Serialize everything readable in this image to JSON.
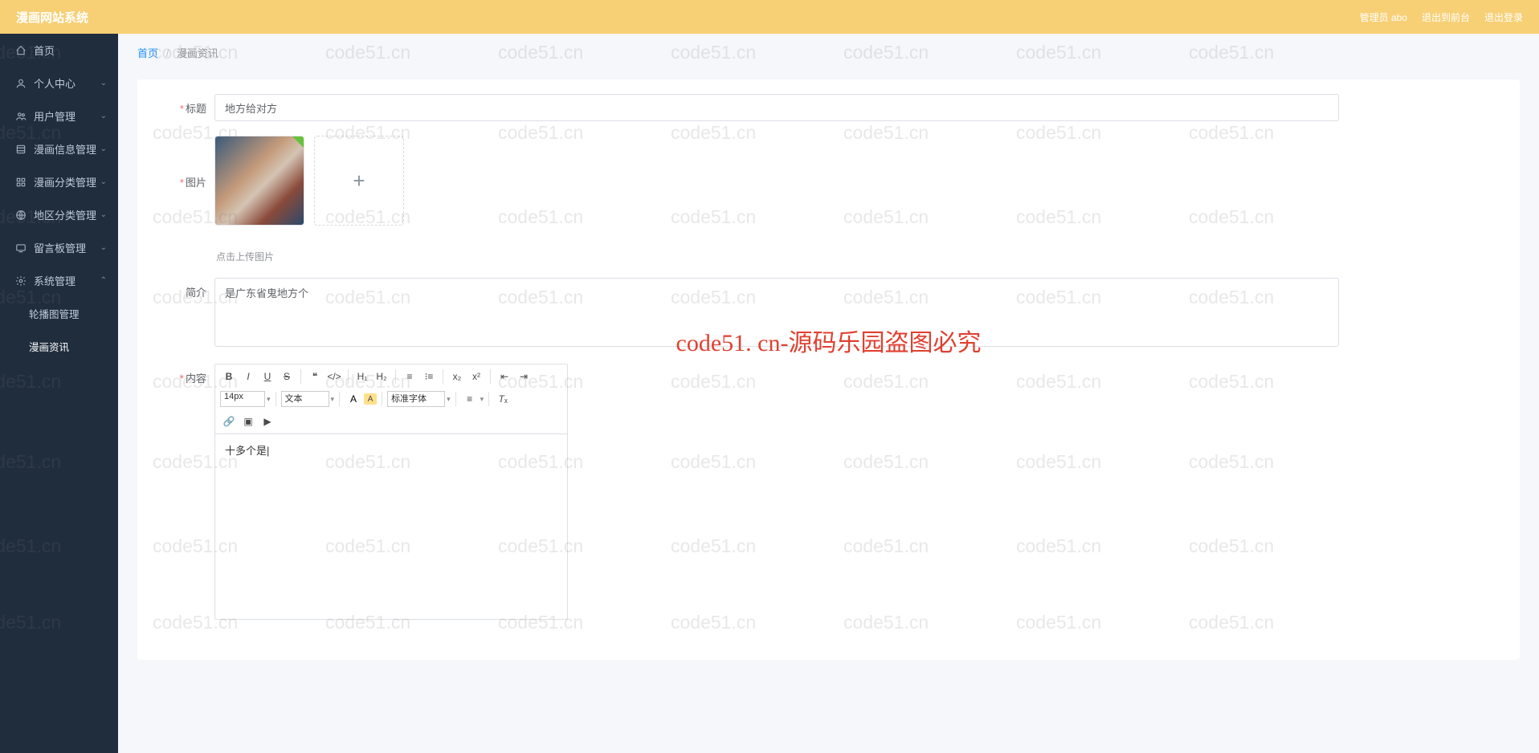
{
  "header": {
    "logo": "漫画网站系统",
    "admin_label": "管理员 abo",
    "exit_to_front": "退出到前台",
    "logout": "退出登录"
  },
  "sidebar": {
    "items": [
      {
        "icon": "home",
        "label": "首页",
        "expandable": false
      },
      {
        "icon": "user",
        "label": "个人中心",
        "expandable": true
      },
      {
        "icon": "users",
        "label": "用户管理",
        "expandable": true
      },
      {
        "icon": "layers",
        "label": "漫画信息管理",
        "expandable": true
      },
      {
        "icon": "grid",
        "label": "漫画分类管理",
        "expandable": true
      },
      {
        "icon": "globe",
        "label": "地区分类管理",
        "expandable": true
      },
      {
        "icon": "message",
        "label": "留言板管理",
        "expandable": true
      },
      {
        "icon": "gear",
        "label": "系统管理",
        "expandable": true,
        "open": true
      }
    ],
    "submenu": [
      {
        "label": "轮播图管理",
        "active": false
      },
      {
        "label": "漫画资讯",
        "active": true
      }
    ]
  },
  "breadcrumb": {
    "home": "首页",
    "current": "漫画资讯"
  },
  "form": {
    "title_label": "标题",
    "title_value": "地方给对方",
    "image_label": "图片",
    "upload_tip": "点击上传图片",
    "intro_label": "简介",
    "intro_value": "是广东省鬼地方个",
    "content_label": "内容",
    "content_value": "十多个是|"
  },
  "editor": {
    "font_size": "14px",
    "para": "文本",
    "font_family": "标准字体"
  },
  "watermark": {
    "center": "code51. cn-源码乐园盗图必究",
    "tile": "code51.cn"
  }
}
